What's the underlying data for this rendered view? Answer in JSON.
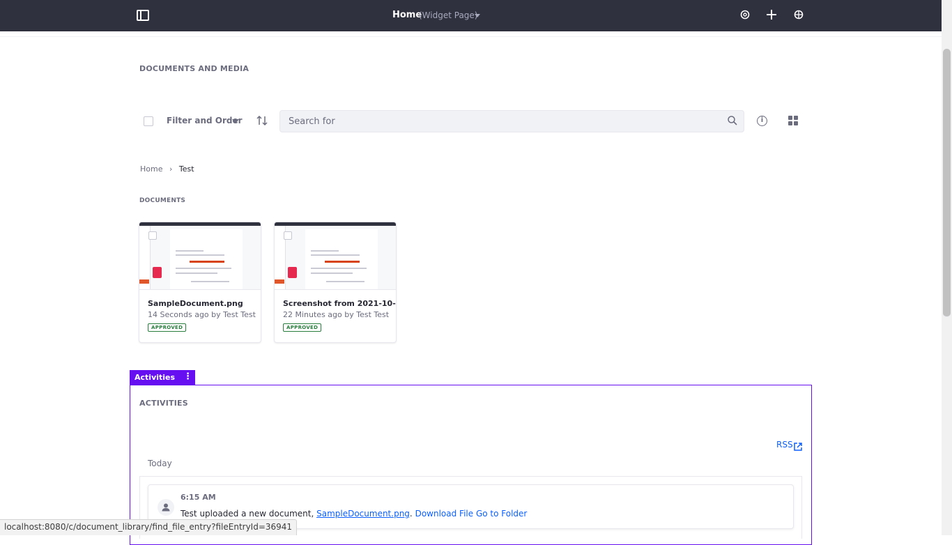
{
  "topbar": {
    "page_title": "Home",
    "page_subtitle": "(Widget Page)",
    "icons": [
      "sidebar-toggle-icon",
      "settings-icon",
      "add-icon",
      "simulation-icon"
    ]
  },
  "documents_media": {
    "title": "DOCUMENTS AND MEDIA",
    "filter_label": "Filter and Order",
    "search_placeholder": "Search for",
    "breadcrumb": [
      "Home",
      "Test"
    ],
    "documents_title": "DOCUMENTS",
    "documents": [
      {
        "title": "SampleDocument.png",
        "meta": "14 Seconds ago by Test Test",
        "status": "APPROVED"
      },
      {
        "title": "Screenshot from 2021-10-...",
        "meta": "22 Minutes ago by Test Test",
        "status": "APPROVED"
      }
    ]
  },
  "activities": {
    "tab_label": "Activities",
    "title": "ACTIVITIES",
    "rss_label": "RSS",
    "group_label": "Today",
    "entries": [
      {
        "time": "6:15 AM",
        "text_prefix": "Test uploaded a new document, ",
        "document_link": "SampleDocument.png",
        "separator": ".",
        "download_label": "Download File",
        "folder_label": "Go to Folder"
      }
    ]
  },
  "statusbar": {
    "url": "localhost:8080/c/document_library/find_file_entry?fileEntryId=36941"
  },
  "colors": {
    "topbar_bg": "#30313f",
    "accent": "#6610f2",
    "link": "#0b5fff",
    "approved": "#287d3c"
  }
}
